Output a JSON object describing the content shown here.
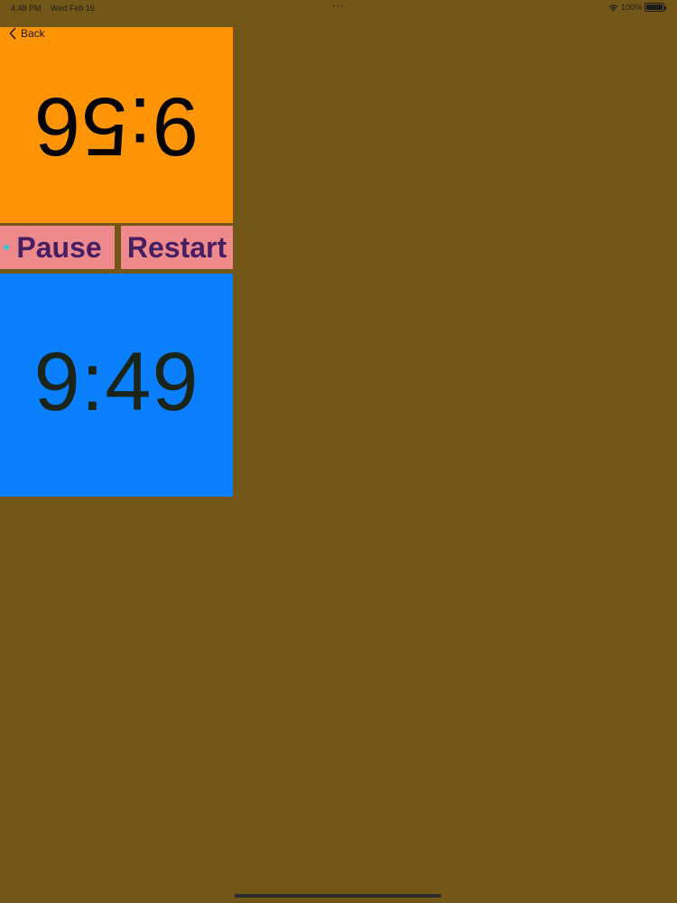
{
  "status_bar": {
    "time": "4:48 PM",
    "date": "Wed Feb 16",
    "multitasking_dots": "•••",
    "battery_percent": "100%",
    "wifi_icon": "wifi-icon",
    "battery_icon": "battery-icon",
    "battery_level": 1.0
  },
  "nav": {
    "back_label": "Back",
    "back_icon": "chevron-left-icon"
  },
  "timers": {
    "top": {
      "value": "9:56",
      "color": "#ff9505",
      "rotated": true
    },
    "bottom": {
      "value": "9:49",
      "color": "#0a80fe",
      "rotated": false
    }
  },
  "controls": {
    "pause_label": "Pause",
    "restart_label": "Restart",
    "button_color": "#ee8a8b",
    "label_color": "#451e64"
  },
  "theme": {
    "background": "#735719"
  }
}
